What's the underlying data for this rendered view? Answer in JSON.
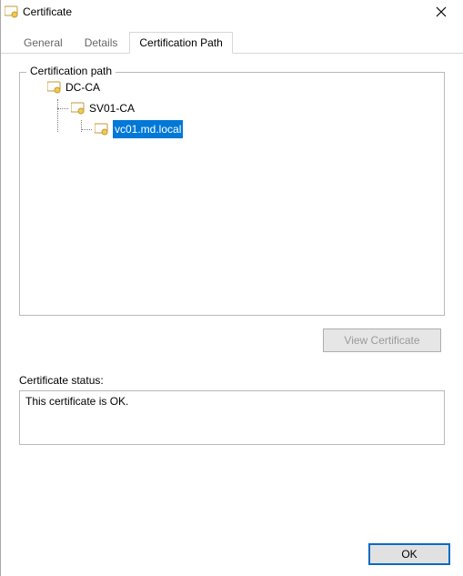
{
  "window": {
    "title": "Certificate"
  },
  "tabs": {
    "general": "General",
    "details": "Details",
    "certpath": "Certification Path"
  },
  "group": {
    "certpath_label": "Certification path"
  },
  "tree": {
    "n0": "DC-CA",
    "n1": "SV01-CA",
    "n2": "vc01.md.local"
  },
  "buttons": {
    "view_cert": "View Certificate",
    "ok": "OK"
  },
  "status": {
    "label": "Certificate status:",
    "text": "This certificate is OK."
  }
}
